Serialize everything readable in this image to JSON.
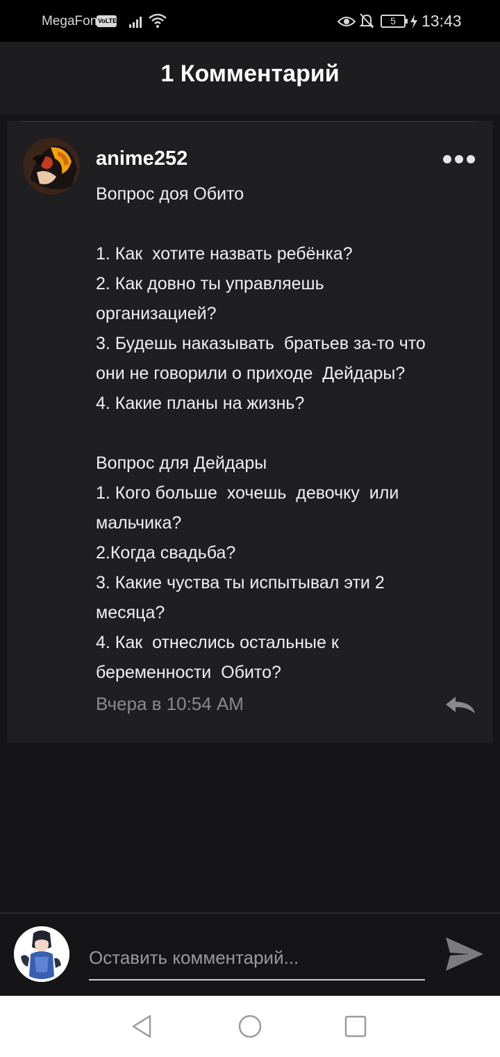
{
  "status_bar": {
    "carrier": "MegaFon",
    "volte": "VoLTE",
    "battery": "5",
    "time": "13:43"
  },
  "header": {
    "title": "1 Комментарий"
  },
  "comment": {
    "username": "anime252",
    "lines": [
      "Вопрос доя Обито",
      "",
      "1. Как  хотите назвать ребёнка?",
      "2. Как довно ты управляешь",
      "организацией?",
      "3. Будешь наказывать  братьев за-то что",
      "они не говорили о приходе  Дейдары?",
      "4. Какие планы на жизнь?",
      "",
      "Вопрос для Дейдары",
      "1. Кого больше  хочешь  девочку  или",
      "мальчика?",
      "2.Когда свадьба?",
      "3. Какие чуства ты испытывал эти 2",
      "месяца?",
      "4. Как  отнеслись остальные к",
      "беременности  Обито?"
    ],
    "timestamp": "Вчера в 10:54 AM",
    "more_icon": "more-horizontal-icon",
    "reply_icon": "reply-arrow-icon"
  },
  "composer": {
    "placeholder": "Оставить комментарий...",
    "send_icon": "send-icon"
  },
  "colors": {
    "background": "#151417",
    "header": "#1d1c1f",
    "card": "#1f1e21",
    "muted_text": "#8a898d"
  }
}
